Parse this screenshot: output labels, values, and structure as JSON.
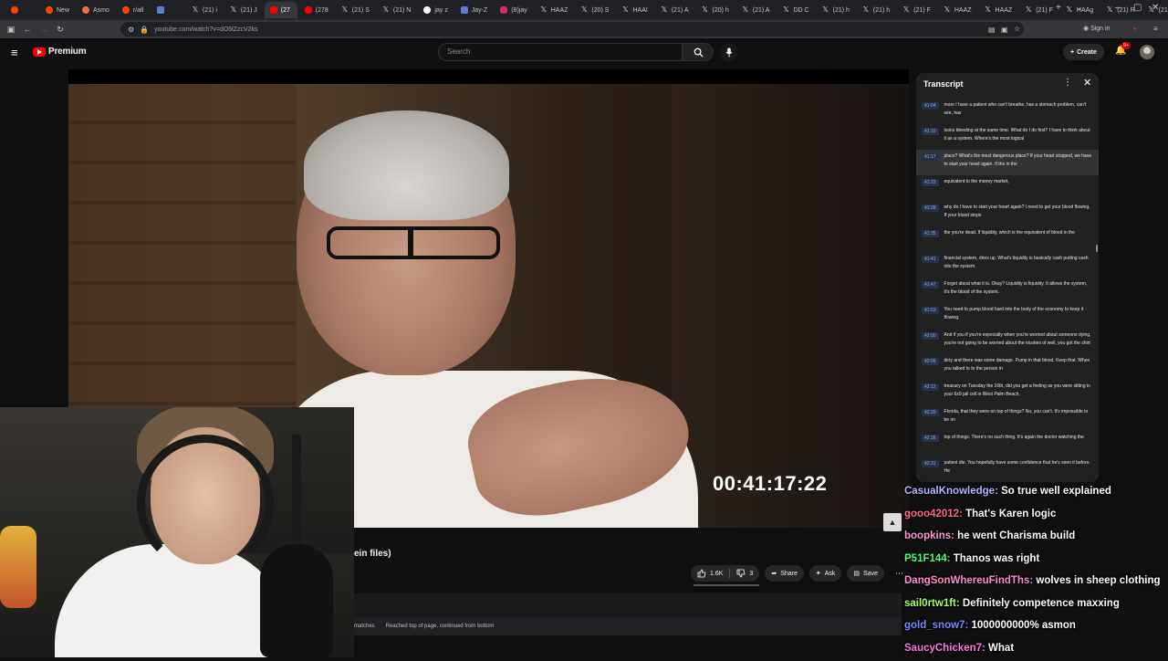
{
  "browser": {
    "tabs": [
      {
        "icon": "rd",
        "label": ""
      },
      {
        "icon": "rd",
        "label": "New"
      },
      {
        "icon": "rs",
        "label": "Asmo"
      },
      {
        "icon": "rd",
        "label": "r/all"
      },
      {
        "icon": "doc",
        "label": ""
      },
      {
        "icon": "x",
        "label": "(21) i"
      },
      {
        "icon": "x",
        "label": "(21) J"
      },
      {
        "icon": "yt",
        "label": "(27"
      },
      {
        "icon": "yt",
        "label": "(278"
      },
      {
        "icon": "x",
        "label": "(21) S"
      },
      {
        "icon": "x",
        "label": "(21) N"
      },
      {
        "icon": "gh",
        "label": "jay z"
      },
      {
        "icon": "doc",
        "label": "Jay-Z"
      },
      {
        "icon": "ig",
        "label": "(8)jay"
      },
      {
        "icon": "x",
        "label": "HAAZ"
      },
      {
        "icon": "x",
        "label": "(20) S"
      },
      {
        "icon": "x",
        "label": "HAAI"
      },
      {
        "icon": "x",
        "label": "(21) A"
      },
      {
        "icon": "x",
        "label": "(20) h"
      },
      {
        "icon": "x",
        "label": "(21) A"
      },
      {
        "icon": "x",
        "label": "DD C"
      },
      {
        "icon": "x",
        "label": "(21) h"
      },
      {
        "icon": "x",
        "label": "(21) h"
      },
      {
        "icon": "x",
        "label": "(21) F"
      },
      {
        "icon": "x",
        "label": "HAAZ"
      },
      {
        "icon": "x",
        "label": "HAAZ"
      },
      {
        "icon": "x",
        "label": "(21) F"
      },
      {
        "icon": "x",
        "label": "HAAg"
      },
      {
        "icon": "x",
        "label": "(21) R"
      },
      {
        "icon": "x",
        "label": "(21) A"
      },
      {
        "icon": "x",
        "label": ""
      }
    ],
    "url": "youtube.com/watch?v=dO5lZzcV2ks",
    "signin": "Sign in"
  },
  "youtube": {
    "logo_text": "Premium",
    "search_placeholder": "Search",
    "create_label": "Create",
    "notif_count": "9+",
    "video": {
      "timecode": "00:41:17:22",
      "title_fragment": "ein files)"
    },
    "actions": {
      "likes": "1.6K",
      "dislikes": "3",
      "share": "Share",
      "ask": "Ask",
      "save": "Save"
    },
    "findbar": {
      "matches": "matches",
      "status": "Reached top of page, continued from bottom"
    },
    "transcript": {
      "title": "Transcript",
      "segments": [
        {
          "ts": "41:04",
          "text": "more I have a patient who can't breathe, has a stomach problem, can't see, has"
        },
        {
          "ts": "41:10",
          "text": "looks bleeding at the same time. What do I do first? I have to think about it as a system. Where's the most logical"
        },
        {
          "ts": "41:17",
          "text": "place? What's the most dangerous place? If your heart stopped, we have to start your heart again. If the in the",
          "active": true
        },
        {
          "ts": "41:23",
          "text": "equivalent to the money market,"
        },
        {
          "ts": "41:28",
          "text": "why do I have to start your heart again? I need to get your blood flowing. If your blood stops"
        },
        {
          "ts": "41:35",
          "text": "the you're dead. If liquidity, which is the equivalent of blood in the"
        },
        {
          "ts": "41:41",
          "text": "financial system, dries up. What's liquidity is basically cash putting cash into the system."
        },
        {
          "ts": "41:47",
          "text": "Forget about what it is. Okay? Liquidity is liquidity. It allows the system, it's the blood of the system."
        },
        {
          "ts": "41:53",
          "text": "You need to pump blood hard into the body of the economy to keep it flowing."
        },
        {
          "ts": "42:00",
          "text": "And if you if you're especially when you're worried about someone dying, you're not going to be worried about the niceties of well, you got the shirt"
        },
        {
          "ts": "42:06",
          "text": "dirty and there was some damage. Pump in that blood. Keep that. When you talked to to the person in"
        },
        {
          "ts": "42:12",
          "text": "treasury on Tuesday the 16th, did you get a feeling as you were sitting in your 6x9 jail cell in West Palm Beach,"
        },
        {
          "ts": "42:20",
          "text": "Florida, that they were on top of things? No, you can't. It's impossible to be on"
        },
        {
          "ts": "42:26",
          "text": "top of things. There's no such thing. It's again the doctor watching the"
        },
        {
          "ts": "42:31",
          "text": "patient die. You hopefully have some confidence that he's seen it before. He"
        }
      ]
    }
  },
  "chat": [
    {
      "user": "CasualKnowledge",
      "color": "#b8b8ff",
      "msg": "So true well explained"
    },
    {
      "user": "gooo42012",
      "color": "#ff6b8a",
      "msg": "That's Karen logic"
    },
    {
      "user": "boopkins",
      "color": "#ff9ad6",
      "msg": "he went Charisma build"
    },
    {
      "user": "P51F144",
      "color": "#4cff7a",
      "msg": "Thanos was right"
    },
    {
      "user": "DangSonWhereuFindThs",
      "color": "#ff8cd0",
      "msg": "wolves in sheep clothing"
    },
    {
      "user": "sail0rtw1ft",
      "color": "#a8ff5a",
      "msg": "Definitely competence maxxing"
    },
    {
      "user": "gold_snow7",
      "color": "#7c8cff",
      "msg": "1000000000% asmon"
    },
    {
      "user": "SaucyChicken7",
      "color": "#ff7ae0",
      "msg": "What"
    }
  ]
}
